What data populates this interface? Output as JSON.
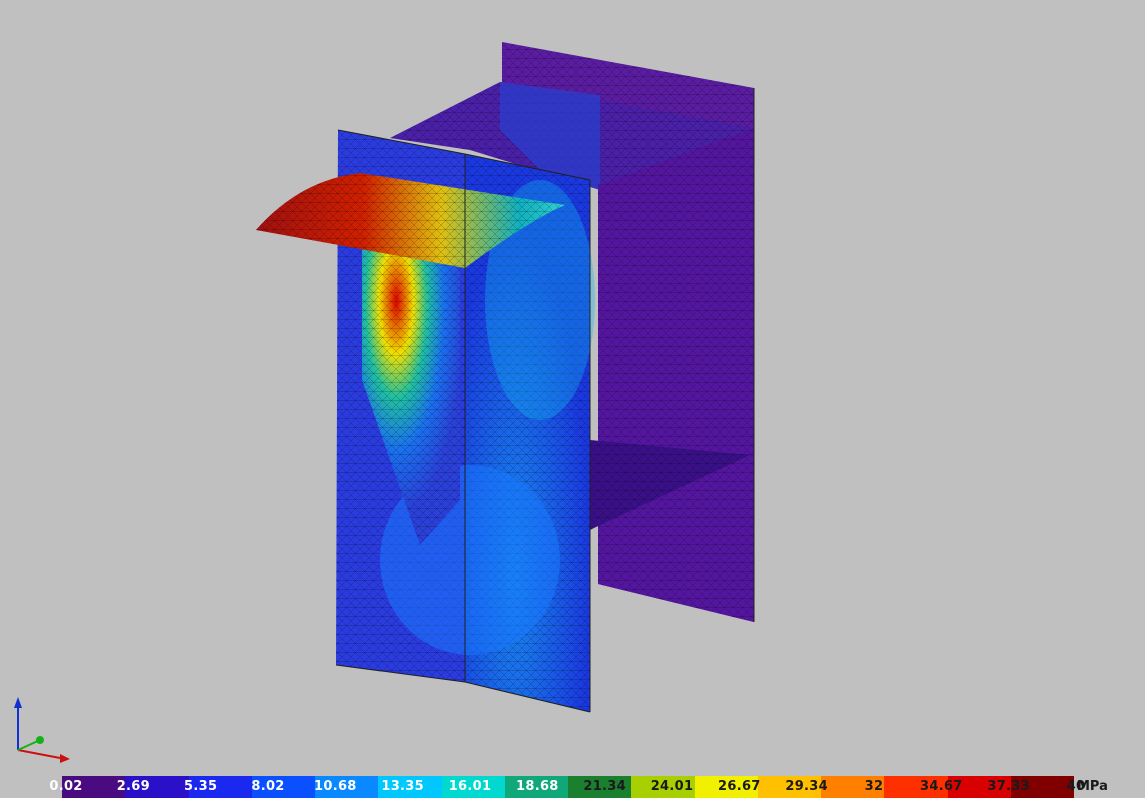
{
  "viewer": {
    "title": "",
    "axis_triad": {
      "x_color": "#cc1010",
      "y_color": "#18b018",
      "z_color": "#1030d0"
    }
  },
  "legend": {
    "unit": "MPa",
    "ticks": [
      "0.02",
      "2.69",
      "5.35",
      "8.02",
      "10.68",
      "13.35",
      "16.01",
      "18.68",
      "21.34",
      "24.01",
      "26.67",
      "29.34",
      "32",
      "34.67",
      "37.33",
      "40"
    ],
    "colors": [
      "#4a0a80",
      "#2a10c8",
      "#1a28f0",
      "#0a50ff",
      "#0a88ff",
      "#00c8ff",
      "#00d8d0",
      "#10a878",
      "#1a8030",
      "#a8d000",
      "#f0f000",
      "#ffc000",
      "#ff8000",
      "#ff3000",
      "#d80000",
      "#800000"
    ],
    "min": 0.02,
    "max": 40
  }
}
